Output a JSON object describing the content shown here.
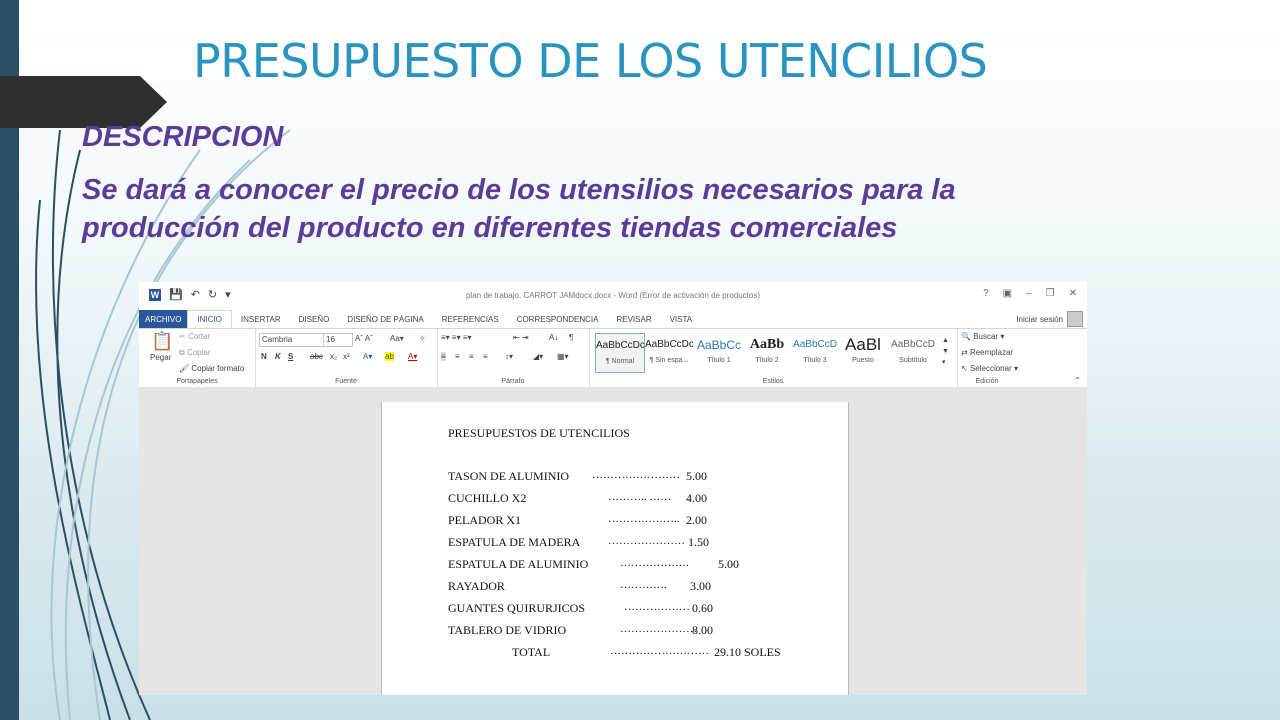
{
  "slide": {
    "title": "PRESUPUESTO DE LOS UTENCILIOS",
    "heading": "DESCRIPCION",
    "body": "Se dará a conocer el precio de los utensilios necesarios para la producción del producto en diferentes tiendas comerciales"
  },
  "word": {
    "window_title": "plan de trabajo. CARROT JAMdocx.docx - Word (Error de activación de productos)",
    "tabs": [
      "ARCHIVO",
      "INICIO",
      "INSERTAR",
      "DISEÑO",
      "DISEÑO DE PÁGINA",
      "REFERENCIAS",
      "CORRESPONDENCIA",
      "REVISAR",
      "VISTA"
    ],
    "signin": "Iniciar sesión",
    "clipboard": {
      "paste": "Pegar",
      "cut": "Cortar",
      "copy": "Copiar",
      "format": "Copiar formato",
      "label": "Portapapeles"
    },
    "font": {
      "name": "Cambria",
      "size": "16",
      "label": "Fuente"
    },
    "paragraph_label": "Párrafo",
    "styles": {
      "label": "Estilos",
      "items": [
        {
          "preview": "AaBbCcDc",
          "name": "¶ Normal"
        },
        {
          "preview": "AaBbCcDc",
          "name": "¶ Sin espa..."
        },
        {
          "preview": "AaBbCc",
          "name": "Título 1"
        },
        {
          "preview": "AaBb",
          "name": "Título 2"
        },
        {
          "preview": "AaBbCcD",
          "name": "Título 3"
        },
        {
          "preview": "AaBl",
          "name": "Puesto"
        },
        {
          "preview": "AaBbCcD",
          "name": "Subtítulo"
        }
      ]
    },
    "editing": {
      "find": "Buscar",
      "replace": "Reemplazar",
      "select": "Seleccionar",
      "label": "Edición"
    }
  },
  "document": {
    "heading": "PRESUPUESTOS  DE  UTENCILIOS",
    "rows": [
      {
        "item": "TASON DE ALUMINIO",
        "dots": "……………………",
        "value": "5.00"
      },
      {
        "item": "CUCHILLO X2",
        "dots": "……….. ……",
        "value": "4.00"
      },
      {
        "item": "PELADOR X1",
        "dots": "………………..",
        "value": "2.00"
      },
      {
        "item": "ESPATULA DE MADERA",
        "dots": "…………………",
        "value": "1.50"
      },
      {
        "item": "ESPATULA DE ALUMINIO",
        "dots": "……………….",
        "value": "5.00"
      },
      {
        "item": "RAYADOR",
        "dots": "………….",
        "value": "3.00"
      },
      {
        "item": "GUANTES QUIRURJICOS",
        "dots": "………………",
        "value": "0.60"
      },
      {
        "item": "TABLERO DE VIDRIO",
        "dots": "…………………",
        "value": "8.00"
      },
      {
        "item": "TOTAL",
        "dots": "………………………",
        "value": "29.10 SOLES"
      }
    ]
  },
  "colors": {
    "title": "#2a93bf",
    "text": "#5a3d98",
    "word_blue": "#2b579a",
    "left_bar": "#2c4f63"
  }
}
